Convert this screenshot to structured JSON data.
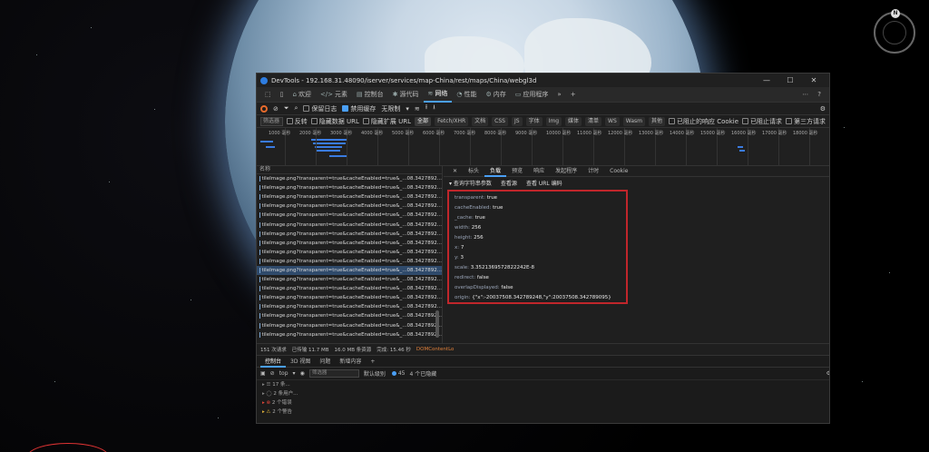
{
  "window": {
    "title": "DevTools - 192.168.31.48090/iserver/services/map-China/rest/maps/China/webgl3d",
    "minimize": "—",
    "maximize": "☐",
    "close": "✕"
  },
  "compass": {
    "label": "N"
  },
  "main_tabs": [
    {
      "icon": "⌂",
      "label": "欢迎"
    },
    {
      "icon": "</>",
      "label": "元素"
    },
    {
      "icon": "▤",
      "label": "控制台"
    },
    {
      "icon": "✱",
      "label": "源代码"
    },
    {
      "icon": "≋",
      "label": "网络"
    },
    {
      "icon": "◔",
      "label": "性能"
    },
    {
      "icon": "⚙",
      "label": "内存"
    },
    {
      "icon": "▭",
      "label": "应用程序"
    }
  ],
  "active_tab_index": 4,
  "toolbar": {
    "preserve_log": "保留日志",
    "disable_cache": "禁用缓存",
    "throttle": "无限制"
  },
  "filter": {
    "placeholder": "筛选器",
    "invert": "反转",
    "hide_data_urls": "隐藏数据 URL",
    "hide_ext_urls": "隐藏扩展 URL",
    "chips": [
      "全部",
      "Fetch/XHR",
      "文档",
      "CSS",
      "JS",
      "字体",
      "Img",
      "媒体",
      "清单",
      "WS",
      "Wasm",
      "其他"
    ],
    "blocked_cookies": "已阻止的响应 Cookie",
    "blocked_requests": "已阻止请求",
    "third_party": "第三方请求"
  },
  "timeline": {
    "ticks": [
      "1000 毫秒",
      "2000 毫秒",
      "3000 毫秒",
      "4000 毫秒",
      "5000 毫秒",
      "6000 毫秒",
      "7000 毫秒",
      "8000 毫秒",
      "9000 毫秒",
      "10000 毫秒",
      "11000 毫秒",
      "12000 毫秒",
      "13000 毫秒",
      "14000 毫秒",
      "15000 毫秒",
      "16000 毫秒",
      "17000 毫秒",
      "18000 毫秒"
    ]
  },
  "requests": {
    "header": "名称",
    "rows": [
      "tileImage.png?transparent=true&cacheEnabled=true&_...08.3427892...",
      "tileImage.png?transparent=true&cacheEnabled=true&_...08.3427892...",
      "tileImage.png?transparent=true&cacheEnabled=true&_...08.3427892...",
      "tileImage.png?transparent=true&cacheEnabled=true&_...08.3427892...",
      "tileImage.png?transparent=true&cacheEnabled=true&_...08.3427892...",
      "tileImage.png?transparent=true&cacheEnabled=true&_...08.3427892...",
      "tileImage.png?transparent=true&cacheEnabled=true&_...08.3427892...",
      "tileImage.png?transparent=true&cacheEnabled=true&_...08.3427892...",
      "tileImage.png?transparent=true&cacheEnabled=true&_...08.3427892...",
      "tileImage.png?transparent=true&cacheEnabled=true&_...08.3427892...",
      "tileImage.png?transparent=true&cacheEnabled=true&_...08.3427892...",
      "tileImage.png?transparent=true&cacheEnabled=true&_...08.3427892...",
      "tileImage.png?transparent=true&cacheEnabled=true&_...08.3427892...",
      "tileImage.png?transparent=true&cacheEnabled=true&_...08.3427892...",
      "tileImage.png?transparent=true&cacheEnabled=true&_...08.3427892...",
      "tileImage.png?transparent=true&cacheEnabled=true&_...08.3427892...",
      "tileImage.png?transparent=true&cacheEnabled=true&_...08.3427892...",
      "tileImage.png?transparent=true&cacheEnabled=true&_...08.3427892..."
    ],
    "selected_index": 10
  },
  "detail": {
    "close": "✕",
    "tabs": [
      "标头",
      "负载",
      "预览",
      "响应",
      "发起程序",
      "计时",
      "Cookie"
    ],
    "active_tab_index": 1,
    "section_title": "▾ 查询字符串参数",
    "view_source": "查看源",
    "view_encoded": "查看 URL 编码",
    "params": [
      {
        "k": "transparent:",
        "v": " true"
      },
      {
        "k": "cacheEnabled:",
        "v": " true"
      },
      {
        "k": "_cache:",
        "v": " true"
      },
      {
        "k": "width:",
        "v": " 256"
      },
      {
        "k": "height:",
        "v": " 256"
      },
      {
        "k": "x:",
        "v": " 7"
      },
      {
        "k": "y:",
        "v": " 3"
      },
      {
        "k": "scale:",
        "v": " 3.3521369572822242E-8"
      },
      {
        "k": "redirect:",
        "v": " false"
      },
      {
        "k": "overlapDisplayed:",
        "v": " false"
      },
      {
        "k": "origin:",
        "v": " {\"x\":-20037508.342789248,\"y\":20037508.342789095}"
      }
    ]
  },
  "status": {
    "requests": "151 次请求",
    "transferred": "已传输 11.7 MB",
    "resources": "16.0 MB 条资源",
    "finish": "完成: 15.46 秒",
    "dcl": "DOMContentLo"
  },
  "drawer": {
    "tabs": [
      "控制台",
      "3D 视图",
      "问题",
      "新增内容"
    ],
    "context": "top",
    "filter_placeholder": "筛选器",
    "level": "默认级别",
    "issues_count": "45",
    "hidden": "4 个已隐藏",
    "lines": [
      "17 条...",
      "2 条用户...",
      "2 个错误",
      "2 个警告"
    ]
  }
}
